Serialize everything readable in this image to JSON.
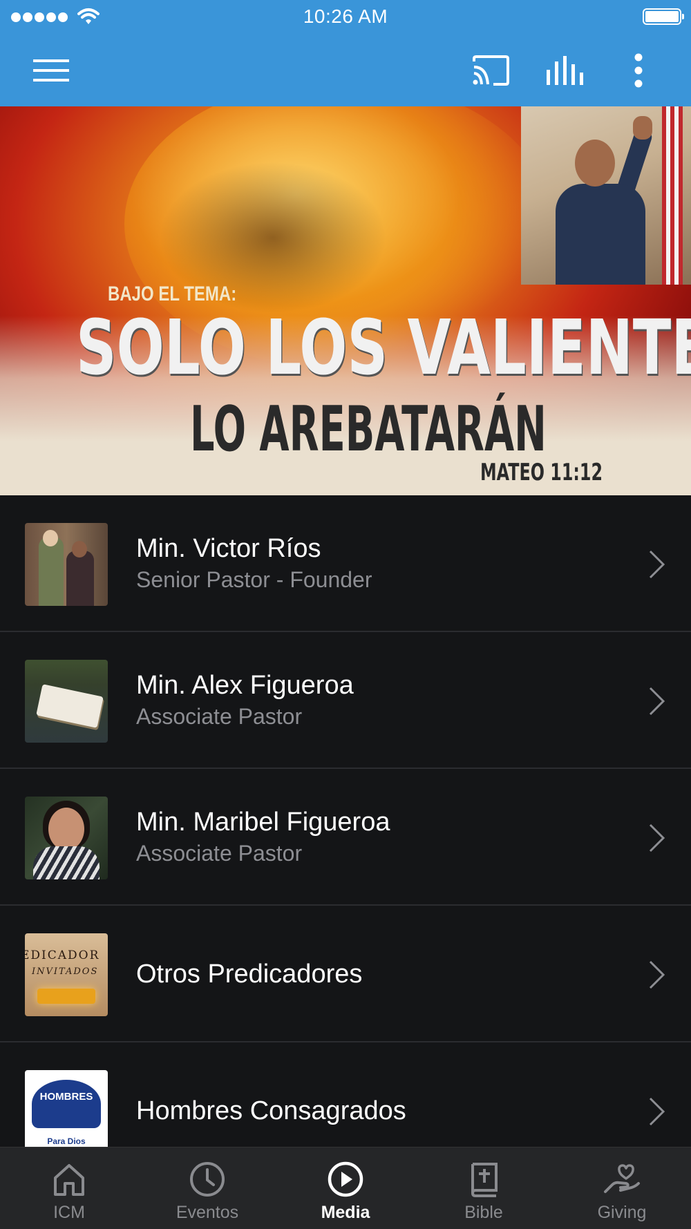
{
  "status_bar": {
    "time": "10:26 AM"
  },
  "app_bar": {
    "menu_icon": "hamburger-menu-icon",
    "cast_icon": "cast-icon",
    "audio_icon": "audio-bars-icon",
    "more_icon": "more-vertical-icon"
  },
  "hero": {
    "kicker": "BAJO EL TEMA:",
    "title_line1": "SOLO LOS VALIENTES",
    "title_line2": "LO AREBATARÁN",
    "verse": "MATEO 11:12"
  },
  "list": {
    "items": [
      {
        "name": "Min. Victor Ríos",
        "subtitle": "Senior Pastor - Founder"
      },
      {
        "name": "Min. Alex Figueroa",
        "subtitle": "Associate Pastor"
      },
      {
        "name": "Min. Maribel Figueroa",
        "subtitle": "Associate Pastor"
      },
      {
        "name": "Otros Predicadores",
        "subtitle": "",
        "thumb_text_1": "EDICADOR",
        "thumb_text_2": "INVITADOS"
      },
      {
        "name": "Hombres Consagrados",
        "subtitle": "",
        "thumb_text_1": "HOMBRES",
        "thumb_text_2": "Para Dios"
      }
    ]
  },
  "tab_bar": {
    "tabs": [
      {
        "label": "ICM",
        "icon": "home-icon"
      },
      {
        "label": "Eventos",
        "icon": "clock-icon"
      },
      {
        "label": "Media",
        "icon": "play-circle-icon"
      },
      {
        "label": "Bible",
        "icon": "bible-icon"
      },
      {
        "label": "Giving",
        "icon": "giving-hand-heart-icon"
      }
    ],
    "active": "Media"
  },
  "colors": {
    "primary": "#3a95d9",
    "background": "#141517",
    "tab_bar": "#252628",
    "subtitle": "#8d8e93"
  }
}
